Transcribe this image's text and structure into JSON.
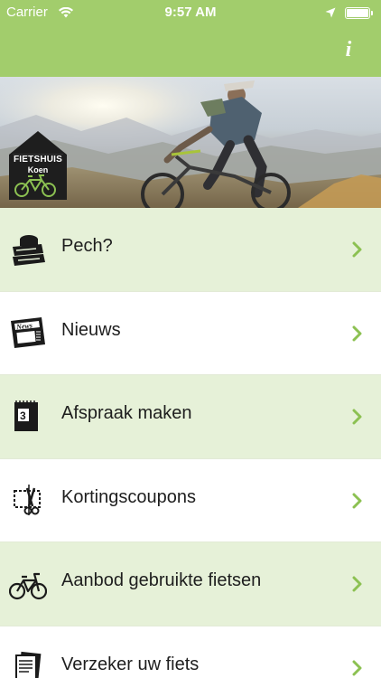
{
  "status_bar": {
    "carrier": "Carrier",
    "time": "9:57 AM"
  },
  "nav": {
    "info_label": "i"
  },
  "hero": {
    "logo_line1": "FIETSHUIS",
    "logo_line2": "Koen"
  },
  "menu": [
    {
      "label": "Pech?",
      "icon": "repair-kit-icon"
    },
    {
      "label": "Nieuws",
      "icon": "newspaper-icon"
    },
    {
      "label": "Afspraak maken",
      "icon": "calendar-icon",
      "icon_text": "3"
    },
    {
      "label": "Kortingscoupons",
      "icon": "scissors-coupon-icon"
    },
    {
      "label": "Aanbod gebruikte fietsen",
      "icon": "bicycle-icon"
    },
    {
      "label": "Verzeker uw fiets",
      "icon": "documents-icon"
    }
  ],
  "colors": {
    "accent": "#a2cd6c",
    "row_alt": "#e6f1d8",
    "chevron": "#8cc152"
  }
}
